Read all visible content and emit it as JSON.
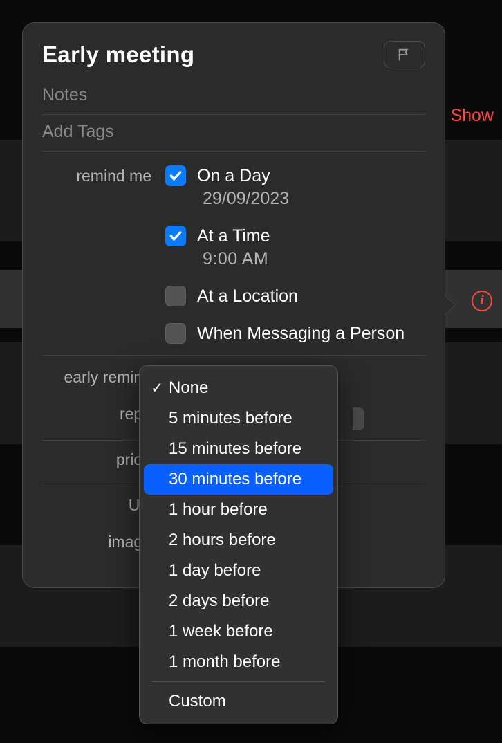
{
  "background": {
    "show_label": "Show"
  },
  "popover": {
    "title": "Early meeting",
    "notes_placeholder": "Notes",
    "tags_placeholder": "Add Tags",
    "labels": {
      "remind_me": "remind me",
      "early_reminder": "early remind",
      "repeat": "repe",
      "priority": "priori",
      "url": "UR",
      "images": "image"
    },
    "options": {
      "on_a_day": {
        "label": "On a Day",
        "checked": true,
        "value": "29/09/2023"
      },
      "at_a_time": {
        "label": "At a Time",
        "checked": true,
        "value": "9:00 AM"
      },
      "at_location": {
        "label": "At a Location",
        "checked": false
      },
      "when_messaging": {
        "label": "When Messaging a Person",
        "checked": false
      }
    }
  },
  "menu": {
    "selected": "None",
    "highlighted": "30 minutes before",
    "items": [
      "None",
      "5 minutes before",
      "15 minutes before",
      "30 minutes before",
      "1 hour before",
      "2 hours before",
      "1 day before",
      "2 days before",
      "1 week before",
      "1 month before"
    ],
    "custom": "Custom"
  }
}
